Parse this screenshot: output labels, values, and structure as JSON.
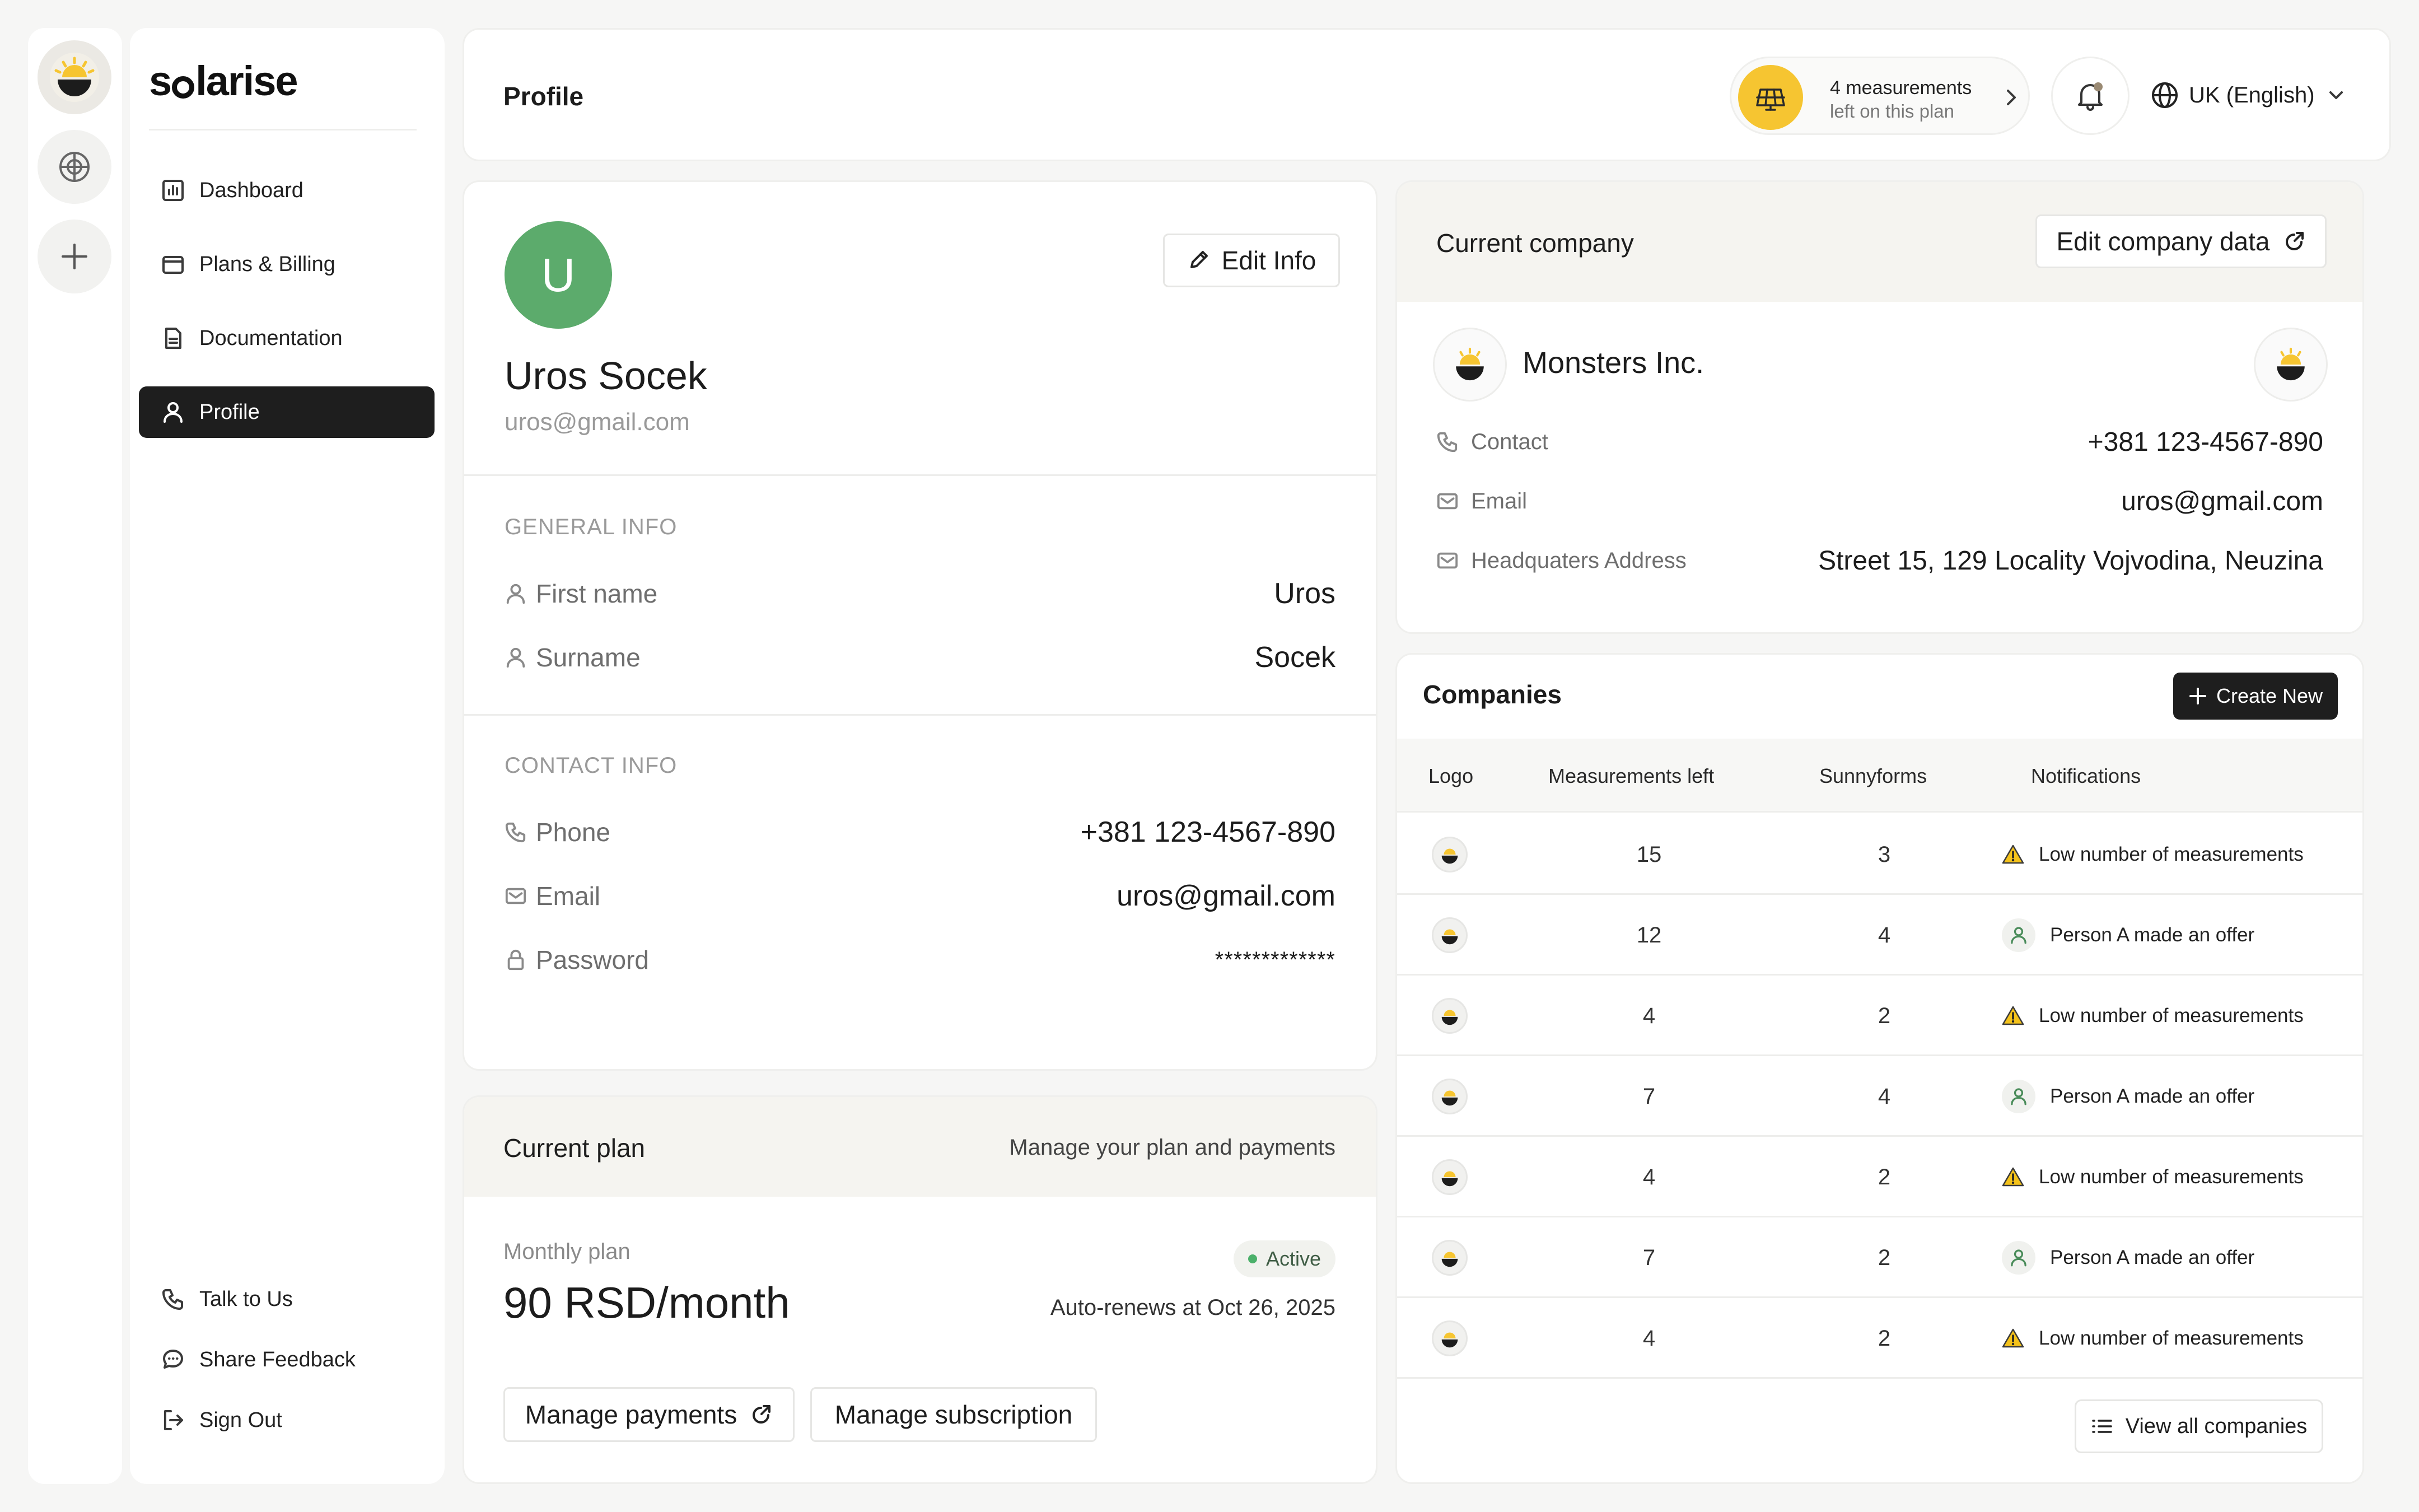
{
  "brand": {
    "logo_prefix": "s",
    "logo_suffix": "larise"
  },
  "sidebar": {
    "items": [
      {
        "label": "Dashboard"
      },
      {
        "label": "Plans & Billing"
      },
      {
        "label": "Documentation"
      },
      {
        "label": "Profile",
        "active": true
      }
    ],
    "footer": [
      {
        "label": "Talk to Us"
      },
      {
        "label": "Share Feedback"
      },
      {
        "label": "Sign Out"
      }
    ]
  },
  "header": {
    "title": "Profile",
    "measurements_main": "4 measurements",
    "measurements_sub": "left on this plan",
    "language": "UK (English)"
  },
  "profile": {
    "avatar_letter": "U",
    "edit_label": "Edit Info",
    "name": "Uros Socek",
    "email": "uros@gmail.com",
    "general_heading": "GENERAL INFO",
    "first_name_label": "First name",
    "first_name": "Uros",
    "surname_label": "Surname",
    "surname": "Socek",
    "contact_heading": "CONTACT INFO",
    "phone_label": "Phone",
    "phone": "+381 123-4567-890",
    "email_label": "Email",
    "password_label": "Password",
    "password": "*************"
  },
  "plan": {
    "title": "Current plan",
    "manage_text": "Manage your plan and payments",
    "type": "Monthly plan",
    "price": "90 RSD/month",
    "status": "Active",
    "renew": "Auto-renews at Oct 26, 2025",
    "manage_payments": "Manage payments",
    "manage_subscription": "Manage subscription"
  },
  "company": {
    "title": "Current company",
    "edit_label": "Edit company data",
    "name": "Monsters Inc.",
    "contact_label": "Contact",
    "contact": "+381 123-4567-890",
    "email_label": "Email",
    "email": "uros@gmail.com",
    "hq_label": "Headquaters Address",
    "hq": "Street 15, 129 Locality Vojvodina, Neuzina"
  },
  "companies": {
    "title": "Companies",
    "create_label": "Create New",
    "columns": [
      "Logo",
      "Measurements left",
      "Sunnyforms",
      "Notifications"
    ],
    "rows": [
      {
        "measurements": "15",
        "sunnyforms": "3",
        "notif_type": "warning",
        "notification": "Low number of measurements"
      },
      {
        "measurements": "12",
        "sunnyforms": "4",
        "notif_type": "person",
        "notification": "Person A made an offer"
      },
      {
        "measurements": "4",
        "sunnyforms": "2",
        "notif_type": "warning",
        "notification": "Low number of measurements"
      },
      {
        "measurements": "7",
        "sunnyforms": "4",
        "notif_type": "person",
        "notification": "Person A made an offer"
      },
      {
        "measurements": "4",
        "sunnyforms": "2",
        "notif_type": "warning",
        "notification": "Low number of measurements"
      },
      {
        "measurements": "7",
        "sunnyforms": "2",
        "notif_type": "person",
        "notification": "Person A made an offer"
      },
      {
        "measurements": "4",
        "sunnyforms": "2",
        "notif_type": "warning",
        "notification": "Low number of measurements"
      }
    ],
    "view_all_label": "View all companies"
  },
  "colors": {
    "accent_yellow": "#f6c531",
    "avatar_green": "#5cab6c",
    "dark": "#1e1e1e",
    "active_green": "#4bb06a",
    "warning": "#f4c21a"
  }
}
